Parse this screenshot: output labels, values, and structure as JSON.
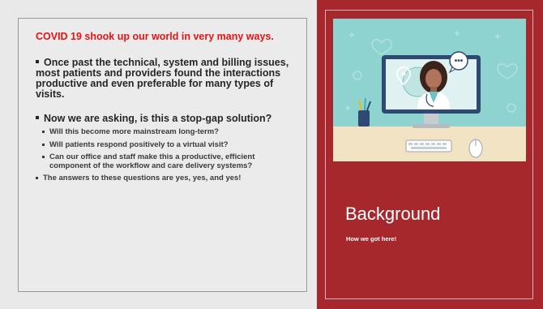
{
  "left": {
    "headline": "COVID 19 shook up our world in very many ways.",
    "bullet1": "Once past the technical, system and billing issues, most patients and providers found the interactions productive and even preferable for many types of visits.",
    "bullet2": "Now we are asking, is this a stop-gap solution?",
    "sub_items": [
      "Will this become more mainstream long-term?",
      "Will patients respond positively to a virtual visit?",
      "Can our office and staff make this a productive, efficient component of the workflow and care delivery systems?"
    ],
    "answer": "The answers to these questions are yes, yes, and yes!"
  },
  "right": {
    "title": "Background",
    "subtitle": "How we got here!",
    "chat_bubble": "•••"
  },
  "colors": {
    "accent_red": "#a6282d",
    "headline_red": "#ee1111",
    "illustration_bg": "#8fd3d1"
  },
  "icons": [
    "location-pin-icon",
    "chat-bubble-icon",
    "keyboard-icon",
    "mouse-icon",
    "pen-cup-icon",
    "stethoscope-icon"
  ]
}
